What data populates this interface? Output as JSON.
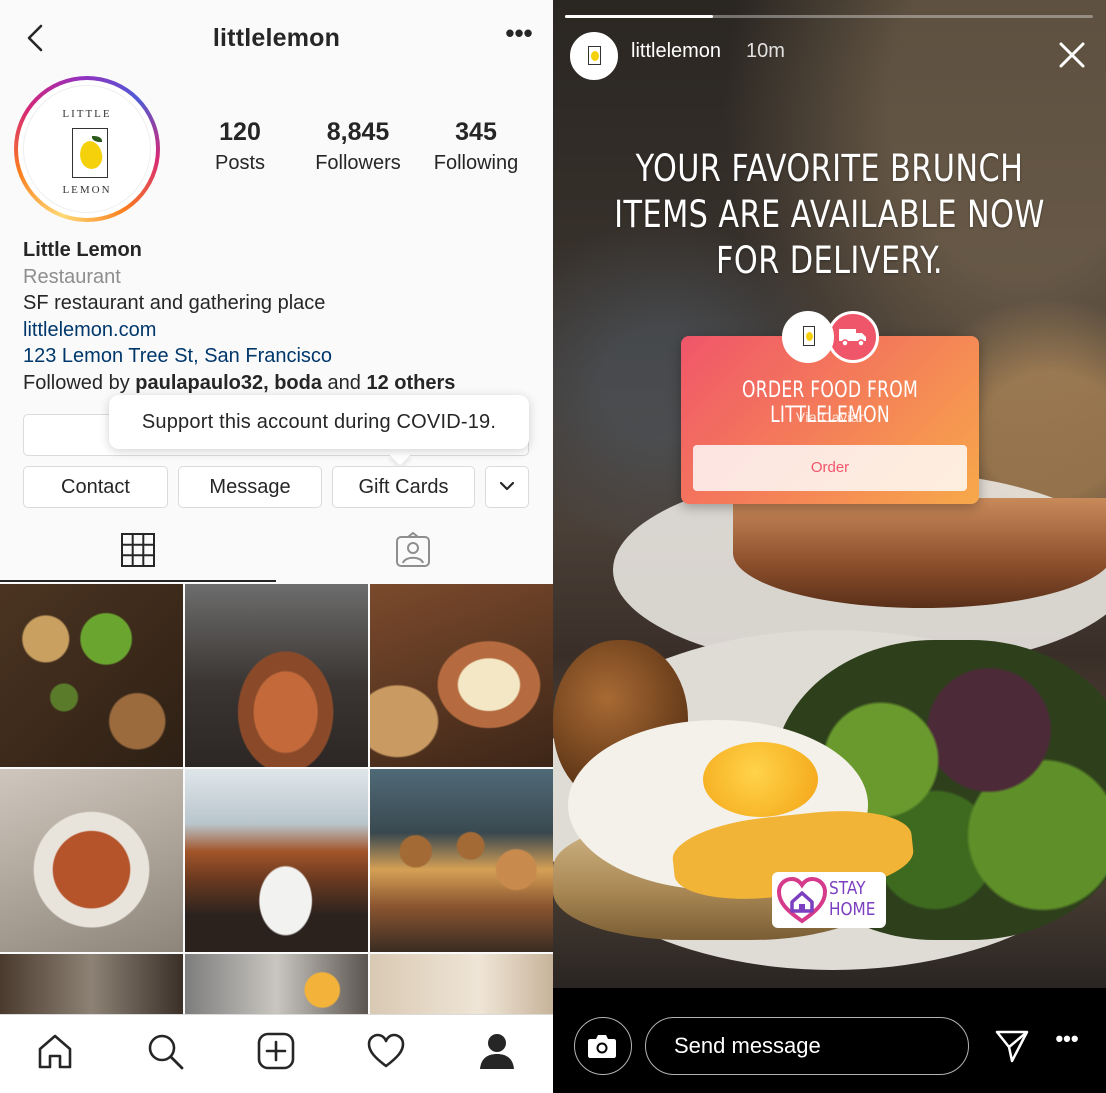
{
  "profile": {
    "header": {
      "title": "littlelemon",
      "more": "•••"
    },
    "avatar": {
      "logo_top": "LITTLE",
      "logo_bottom": "LEMON"
    },
    "stats": [
      {
        "value": "120",
        "label": "Posts"
      },
      {
        "value": "8,845",
        "label": "Followers"
      },
      {
        "value": "345",
        "label": "Following"
      }
    ],
    "bio": {
      "name": "Little Lemon",
      "category": "Restaurant",
      "description": "SF restaurant and gathering place",
      "website": "littlelemon.com",
      "address": "123 Lemon Tree St, San Francisco",
      "followed_prefix": "Followed by ",
      "followed_names": "paulapaulo32, boda",
      "followed_mid": " and ",
      "followed_others": "12 others"
    },
    "tooltip": "Support this account during COVID-19.",
    "buttons": {
      "contact": "Contact",
      "message": "Message",
      "gift_cards": "Gift Cards"
    },
    "tabs": [
      "grid",
      "tagged"
    ],
    "grid_posts": [
      "lentils-avocado-bread",
      "grilled-squid",
      "hummus-plate",
      "seafood-pasta",
      "coffee-cup",
      "sliders-board",
      "window-interior",
      "cocktails",
      "patio"
    ],
    "bottom_nav": [
      "home",
      "search",
      "new-post",
      "activity",
      "profile"
    ]
  },
  "story": {
    "progress": 0.28,
    "username": "littlelemon",
    "time": "10m",
    "headline_lines": [
      "YOUR FAVORITE BRUNCH",
      "ITEMS ARE AVAILABLE NOW",
      "FOR DELIVERY."
    ],
    "order_card": {
      "title": "ORDER FOOD FROM LITTLELEMON",
      "subtitle": "Via Caviar",
      "button": "Order"
    },
    "sticker": {
      "line1": "STAY",
      "line2": "HOME"
    },
    "footer": {
      "placeholder": "Send message"
    },
    "colors": {
      "order_gradient_start": "#f0566a",
      "order_gradient_end": "#f7a94a",
      "stay_home": "#7b3fbf"
    }
  }
}
